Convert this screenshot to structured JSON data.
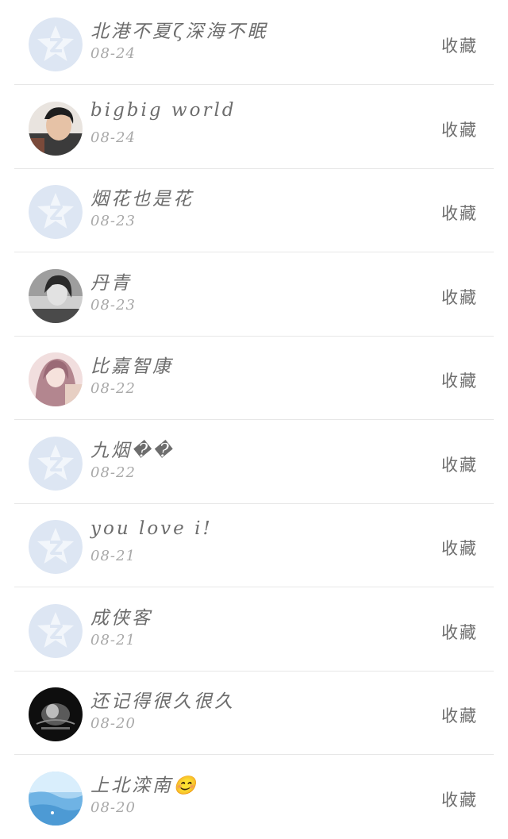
{
  "list": {
    "items": [
      {
        "name": "北港不夏ζ深海不眠",
        "date": "08-24",
        "action": "收藏",
        "avatar": "default"
      },
      {
        "name": "bigbig world",
        "date": "08-24",
        "action": "收藏",
        "avatar": "photo-boy"
      },
      {
        "name": "烟花也是花",
        "date": "08-23",
        "action": "收藏",
        "avatar": "default"
      },
      {
        "name": "丹青",
        "date": "08-23",
        "action": "收藏",
        "avatar": "photo-girl-gray"
      },
      {
        "name": "比嘉智康",
        "date": "08-22",
        "action": "收藏",
        "avatar": "photo-anime-pink"
      },
      {
        "name": "九烟��",
        "date": "08-22",
        "action": "收藏",
        "avatar": "default"
      },
      {
        "name": "you love i!",
        "date": "08-21",
        "action": "收藏",
        "avatar": "default"
      },
      {
        "name": "成侠客",
        "date": "08-21",
        "action": "收藏",
        "avatar": "default"
      },
      {
        "name": "还记得很久很久",
        "date": "08-20",
        "action": "收藏",
        "avatar": "photo-dark"
      },
      {
        "name": "上北滦南😊",
        "date": "08-20",
        "action": "收藏",
        "avatar": "photo-sky"
      }
    ]
  }
}
